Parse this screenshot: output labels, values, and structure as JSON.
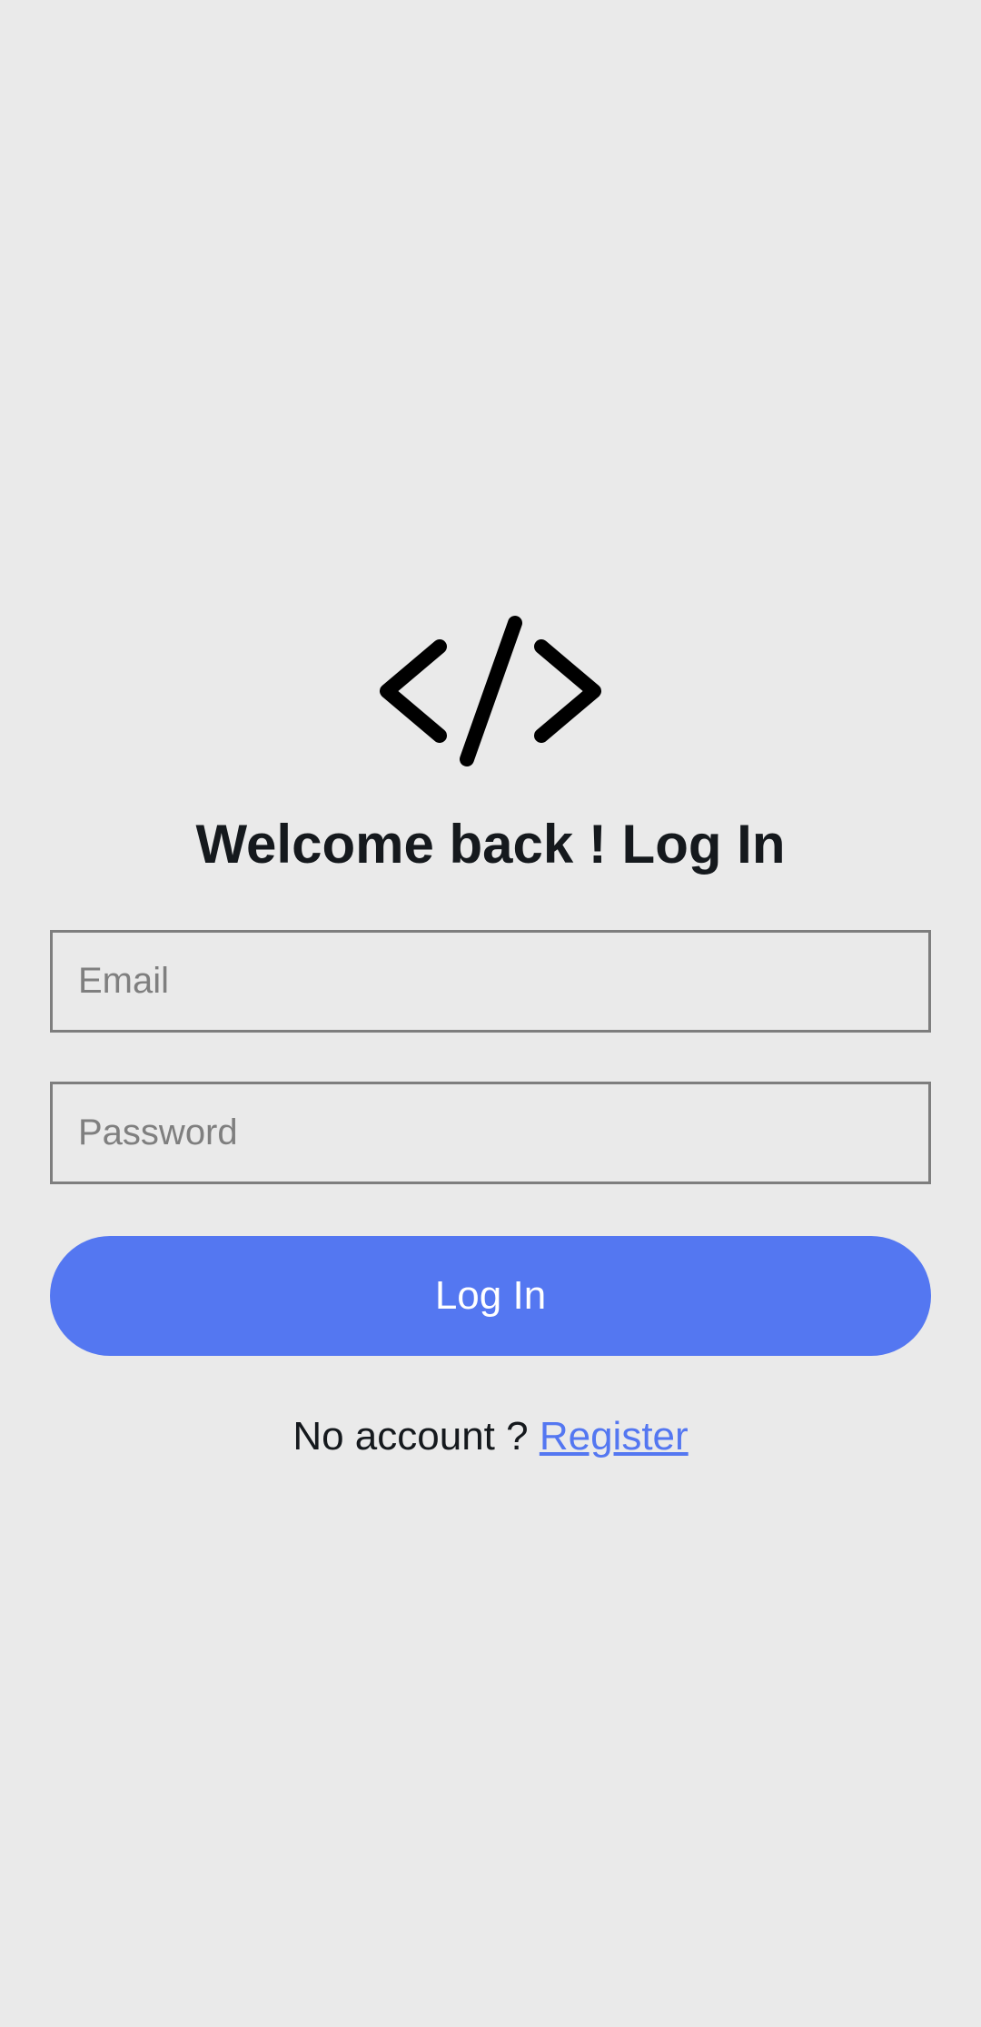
{
  "app_icon": "code-brackets-icon",
  "title": "Welcome back ! Log In",
  "email_field": {
    "placeholder": "Email",
    "value": ""
  },
  "password_field": {
    "placeholder": "Password",
    "value": ""
  },
  "login_button": {
    "label": "Log In"
  },
  "register": {
    "prompt": "No account ? ",
    "link_label": "Register"
  },
  "colors": {
    "background": "#EAEAEA",
    "accent": "#5477F1",
    "text": "#15191D",
    "border": "#7E7E7E"
  }
}
